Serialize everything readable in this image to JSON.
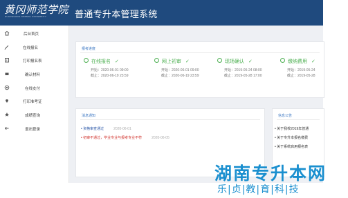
{
  "header": {
    "logo_cn": "黄冈师范学院",
    "logo_en": "HUANGGANG NORMAL UNIVERSITY",
    "title": "普通专升本管理系统"
  },
  "sidebar": {
    "items": [
      {
        "label": "后台首页",
        "icon": "home-icon"
      },
      {
        "label": "在线报名",
        "icon": "pencil-icon"
      },
      {
        "label": "打印报名表",
        "icon": "print-icon"
      },
      {
        "label": "确认材料",
        "icon": "folder-icon"
      },
      {
        "label": "在线支付",
        "icon": "payment-icon"
      },
      {
        "label": "打印准考证",
        "icon": "location-icon"
      },
      {
        "label": "成绩查询",
        "icon": "star-icon"
      },
      {
        "label": "退出登录",
        "icon": "arrow-left-icon"
      }
    ]
  },
  "progress": {
    "title": "报考进度",
    "steps": [
      {
        "name": "在线报名",
        "start": "开始：2020-06-01 09:00",
        "end": "截止：2020-06-19 23:59"
      },
      {
        "name": "网上初审",
        "start": "开始：2020-06-01 09:00",
        "end": "截止：2020-06-19 23:59"
      },
      {
        "name": "现场确认",
        "start": "开始：2019-05-24 08:00",
        "end": "截止：2019-05-28 17:00"
      },
      {
        "name": "缴纳费用",
        "start": "开始：2019-05-24",
        "end": "截止：2019-05-28"
      }
    ]
  },
  "notices": {
    "title": "消息通知",
    "items": [
      {
        "text": "资格审查通过",
        "date": "2020-06-01",
        "color": "#2b57a8"
      },
      {
        "text": "初审不通过，毕业专业与报考专业不符",
        "date": "2020-06-05",
        "color": "#d0302a"
      }
    ]
  },
  "announcements": {
    "title": "信息公告",
    "items": [
      {
        "text": "关于我校2019年普通"
      },
      {
        "text": "关于专升本报名缴费"
      },
      {
        "text": "关于系统启用报名表"
      }
    ]
  },
  "watermark": {
    "main": "湖南专升本网",
    "sub": "乐|贞|教|育|科|技"
  },
  "colors": {
    "header_bg": "#1f4a7e",
    "accent_blue": "#3a76c2",
    "step_green": "#4caf50",
    "watermark": "#1a8fcf"
  }
}
